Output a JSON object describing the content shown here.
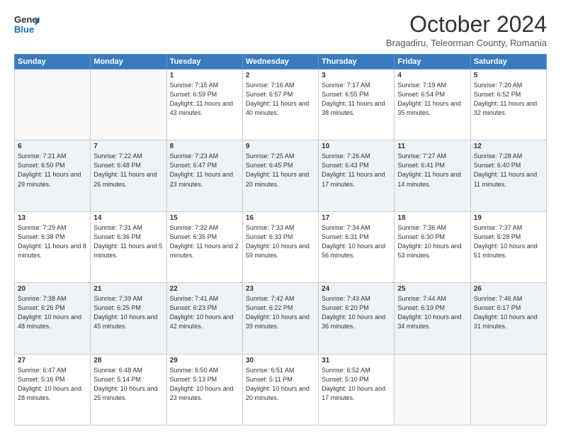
{
  "header": {
    "logo": {
      "general": "General",
      "blue": "Blue"
    },
    "title": "October 2024",
    "subtitle": "Bragadiru, Teleorman County, Romania"
  },
  "calendar": {
    "headers": [
      "Sunday",
      "Monday",
      "Tuesday",
      "Wednesday",
      "Thursday",
      "Friday",
      "Saturday"
    ],
    "weeks": [
      [
        {
          "day": "",
          "sunrise": "",
          "sunset": "",
          "daylight": "",
          "empty": true
        },
        {
          "day": "",
          "sunrise": "",
          "sunset": "",
          "daylight": "",
          "empty": true
        },
        {
          "day": "1",
          "sunrise": "Sunrise: 7:15 AM",
          "sunset": "Sunset: 6:59 PM",
          "daylight": "Daylight: 11 hours and 43 minutes.",
          "empty": false
        },
        {
          "day": "2",
          "sunrise": "Sunrise: 7:16 AM",
          "sunset": "Sunset: 6:57 PM",
          "daylight": "Daylight: 11 hours and 40 minutes.",
          "empty": false
        },
        {
          "day": "3",
          "sunrise": "Sunrise: 7:17 AM",
          "sunset": "Sunset: 6:55 PM",
          "daylight": "Daylight: 11 hours and 38 minutes.",
          "empty": false
        },
        {
          "day": "4",
          "sunrise": "Sunrise: 7:19 AM",
          "sunset": "Sunset: 6:54 PM",
          "daylight": "Daylight: 11 hours and 35 minutes.",
          "empty": false
        },
        {
          "day": "5",
          "sunrise": "Sunrise: 7:20 AM",
          "sunset": "Sunset: 6:52 PM",
          "daylight": "Daylight: 11 hours and 32 minutes.",
          "empty": false
        }
      ],
      [
        {
          "day": "6",
          "sunrise": "Sunrise: 7:21 AM",
          "sunset": "Sunset: 6:50 PM",
          "daylight": "Daylight: 11 hours and 29 minutes.",
          "empty": false
        },
        {
          "day": "7",
          "sunrise": "Sunrise: 7:22 AM",
          "sunset": "Sunset: 6:48 PM",
          "daylight": "Daylight: 11 hours and 26 minutes.",
          "empty": false
        },
        {
          "day": "8",
          "sunrise": "Sunrise: 7:23 AM",
          "sunset": "Sunset: 6:47 PM",
          "daylight": "Daylight: 11 hours and 23 minutes.",
          "empty": false
        },
        {
          "day": "9",
          "sunrise": "Sunrise: 7:25 AM",
          "sunset": "Sunset: 6:45 PM",
          "daylight": "Daylight: 11 hours and 20 minutes.",
          "empty": false
        },
        {
          "day": "10",
          "sunrise": "Sunrise: 7:26 AM",
          "sunset": "Sunset: 6:43 PM",
          "daylight": "Daylight: 11 hours and 17 minutes.",
          "empty": false
        },
        {
          "day": "11",
          "sunrise": "Sunrise: 7:27 AM",
          "sunset": "Sunset: 6:41 PM",
          "daylight": "Daylight: 11 hours and 14 minutes.",
          "empty": false
        },
        {
          "day": "12",
          "sunrise": "Sunrise: 7:28 AM",
          "sunset": "Sunset: 6:40 PM",
          "daylight": "Daylight: 11 hours and 11 minutes.",
          "empty": false
        }
      ],
      [
        {
          "day": "13",
          "sunrise": "Sunrise: 7:29 AM",
          "sunset": "Sunset: 6:38 PM",
          "daylight": "Daylight: 11 hours and 8 minutes.",
          "empty": false
        },
        {
          "day": "14",
          "sunrise": "Sunrise: 7:31 AM",
          "sunset": "Sunset: 6:36 PM",
          "daylight": "Daylight: 11 hours and 5 minutes.",
          "empty": false
        },
        {
          "day": "15",
          "sunrise": "Sunrise: 7:32 AM",
          "sunset": "Sunset: 6:35 PM",
          "daylight": "Daylight: 11 hours and 2 minutes.",
          "empty": false
        },
        {
          "day": "16",
          "sunrise": "Sunrise: 7:33 AM",
          "sunset": "Sunset: 6:33 PM",
          "daylight": "Daylight: 10 hours and 59 minutes.",
          "empty": false
        },
        {
          "day": "17",
          "sunrise": "Sunrise: 7:34 AM",
          "sunset": "Sunset: 6:31 PM",
          "daylight": "Daylight: 10 hours and 56 minutes.",
          "empty": false
        },
        {
          "day": "18",
          "sunrise": "Sunrise: 7:36 AM",
          "sunset": "Sunset: 6:30 PM",
          "daylight": "Daylight: 10 hours and 53 minutes.",
          "empty": false
        },
        {
          "day": "19",
          "sunrise": "Sunrise: 7:37 AM",
          "sunset": "Sunset: 6:28 PM",
          "daylight": "Daylight: 10 hours and 51 minutes.",
          "empty": false
        }
      ],
      [
        {
          "day": "20",
          "sunrise": "Sunrise: 7:38 AM",
          "sunset": "Sunset: 6:26 PM",
          "daylight": "Daylight: 10 hours and 48 minutes.",
          "empty": false
        },
        {
          "day": "21",
          "sunrise": "Sunrise: 7:39 AM",
          "sunset": "Sunset: 6:25 PM",
          "daylight": "Daylight: 10 hours and 45 minutes.",
          "empty": false
        },
        {
          "day": "22",
          "sunrise": "Sunrise: 7:41 AM",
          "sunset": "Sunset: 6:23 PM",
          "daylight": "Daylight: 10 hours and 42 minutes.",
          "empty": false
        },
        {
          "day": "23",
          "sunrise": "Sunrise: 7:42 AM",
          "sunset": "Sunset: 6:22 PM",
          "daylight": "Daylight: 10 hours and 39 minutes.",
          "empty": false
        },
        {
          "day": "24",
          "sunrise": "Sunrise: 7:43 AM",
          "sunset": "Sunset: 6:20 PM",
          "daylight": "Daylight: 10 hours and 36 minutes.",
          "empty": false
        },
        {
          "day": "25",
          "sunrise": "Sunrise: 7:44 AM",
          "sunset": "Sunset: 6:19 PM",
          "daylight": "Daylight: 10 hours and 34 minutes.",
          "empty": false
        },
        {
          "day": "26",
          "sunrise": "Sunrise: 7:46 AM",
          "sunset": "Sunset: 6:17 PM",
          "daylight": "Daylight: 10 hours and 31 minutes.",
          "empty": false
        }
      ],
      [
        {
          "day": "27",
          "sunrise": "Sunrise: 6:47 AM",
          "sunset": "Sunset: 5:16 PM",
          "daylight": "Daylight: 10 hours and 28 minutes.",
          "empty": false
        },
        {
          "day": "28",
          "sunrise": "Sunrise: 6:48 AM",
          "sunset": "Sunset: 5:14 PM",
          "daylight": "Daylight: 10 hours and 25 minutes.",
          "empty": false
        },
        {
          "day": "29",
          "sunrise": "Sunrise: 6:50 AM",
          "sunset": "Sunset: 5:13 PM",
          "daylight": "Daylight: 10 hours and 23 minutes.",
          "empty": false
        },
        {
          "day": "30",
          "sunrise": "Sunrise: 6:51 AM",
          "sunset": "Sunset: 5:11 PM",
          "daylight": "Daylight: 10 hours and 20 minutes.",
          "empty": false
        },
        {
          "day": "31",
          "sunrise": "Sunrise: 6:52 AM",
          "sunset": "Sunset: 5:10 PM",
          "daylight": "Daylight: 10 hours and 17 minutes.",
          "empty": false
        },
        {
          "day": "",
          "sunrise": "",
          "sunset": "",
          "daylight": "",
          "empty": true
        },
        {
          "day": "",
          "sunrise": "",
          "sunset": "",
          "daylight": "",
          "empty": true
        }
      ]
    ]
  }
}
